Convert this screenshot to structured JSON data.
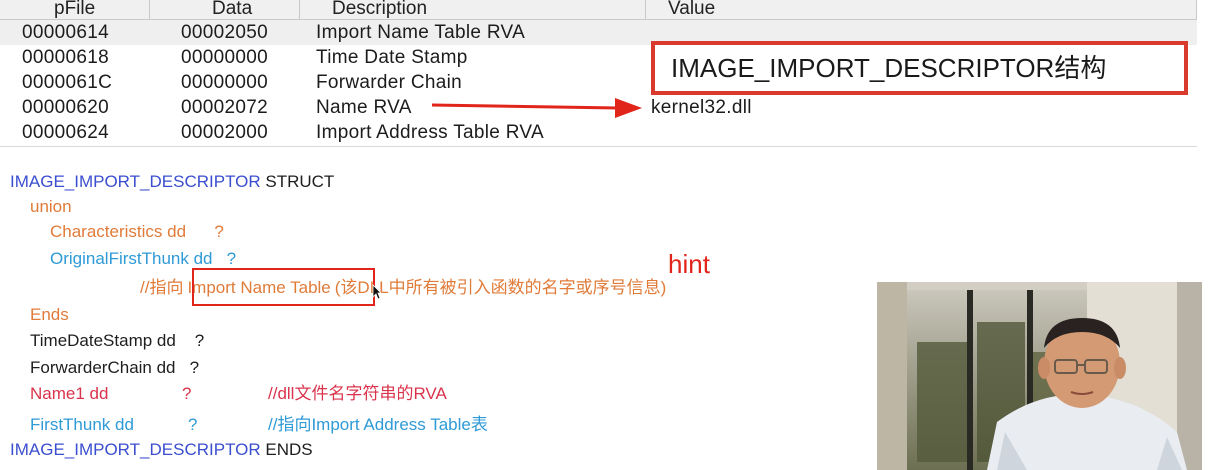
{
  "table": {
    "headers": [
      "pFile",
      "Data",
      "Description",
      "Value"
    ],
    "rows": [
      {
        "pfile": "00000614",
        "data": "00002050",
        "description": "Import Name Table RVA",
        "value": ""
      },
      {
        "pfile": "00000618",
        "data": "00000000",
        "description": "Time Date Stamp",
        "value": ""
      },
      {
        "pfile": "0000061C",
        "data": "00000000",
        "description": "Forwarder Chain",
        "value": ""
      },
      {
        "pfile": "00000620",
        "data": "00002072",
        "description": "Name RVA",
        "value": "kernel32.dll"
      },
      {
        "pfile": "00000624",
        "data": "00002000",
        "description": "Import Address Table RVA",
        "value": ""
      }
    ],
    "selected_row": 0
  },
  "annotation": {
    "struct_label": "IMAGE_IMPORT_DESCRIPTOR结构",
    "hint": "hint",
    "arrow_color": "#e1251b"
  },
  "code": {
    "line1_name": "IMAGE_IMPORT_DESCRIPTOR",
    "line1_kw": " STRUCT",
    "union": "union",
    "characteristics": "Characteristics dd      ?",
    "oft": "OriginalFirstThunk dd   ?",
    "comment_pre": "//指向",
    "comment_box": "Import Name Table",
    "comment_post": "(该DLL中所有被引入函数的名字或序号信息)",
    "ends": "Ends",
    "timedatestamp": "TimeDateStamp dd    ?",
    "forwarderchain": "ForwarderChain dd   ?",
    "name1": "Name1 dd",
    "name1_q": "?",
    "name1_comment": "//dll文件名字符串的RVA",
    "firstthunk": "FirstThunk dd",
    "firstthunk_q": "?",
    "firstthunk_comment": "//指向Import Address Table表",
    "last_name": "IMAGE_IMPORT_DESCRIPTOR",
    "last_kw": " ENDS"
  },
  "colors": {
    "keyword_blue": "#3a4ecf",
    "orange": "#e07b39",
    "cyan": "#2e9ad6",
    "red": "#d9344c",
    "highlight_red": "#e1251b"
  }
}
